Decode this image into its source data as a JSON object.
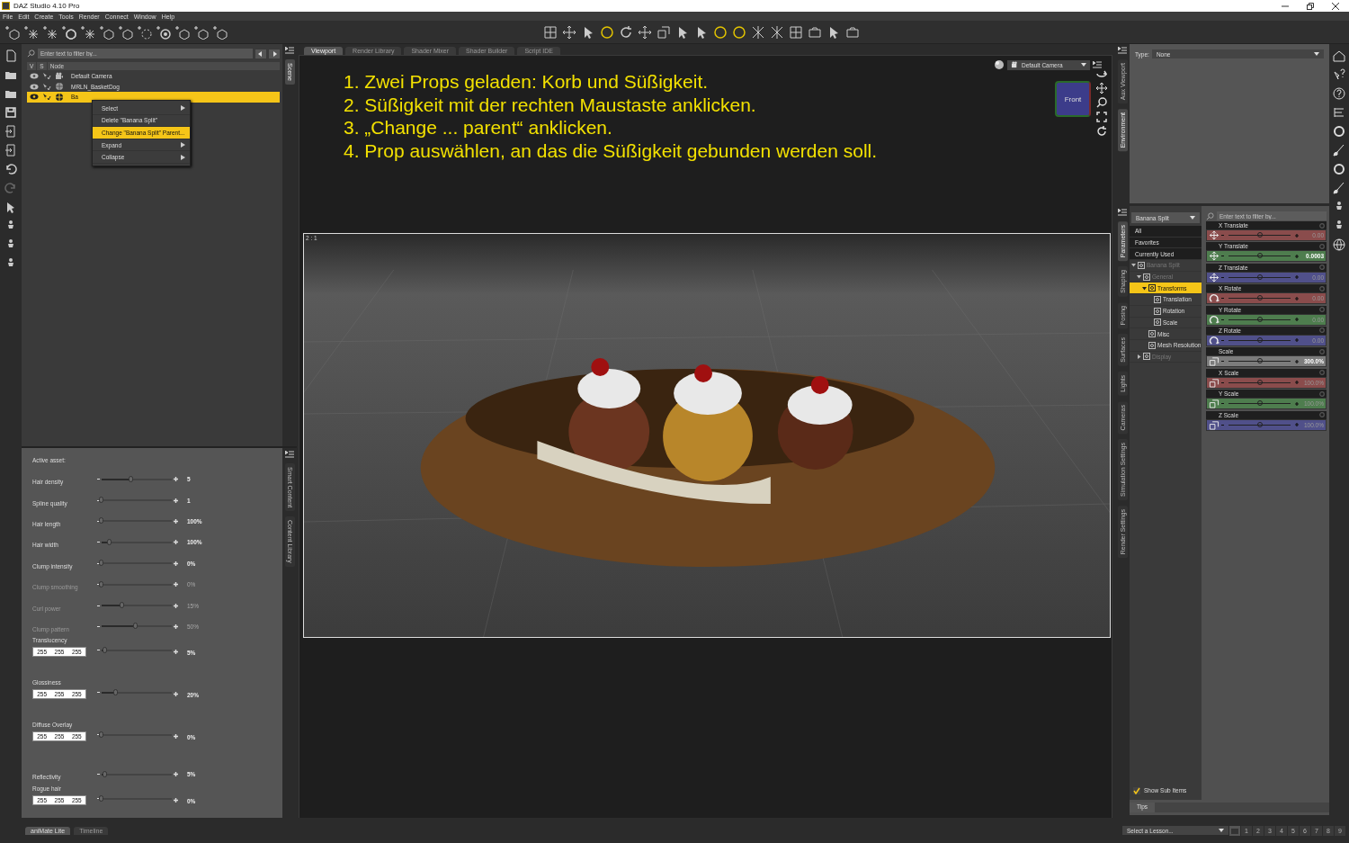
{
  "window": {
    "title": "DAZ Studio 4.10 Pro"
  },
  "menu": [
    "File",
    "Edit",
    "Create",
    "Tools",
    "Render",
    "Connect",
    "Window",
    "Help"
  ],
  "scene": {
    "side_tabs": [
      {
        "label": "Scene",
        "selected": true
      }
    ],
    "filter_placeholder": "Enter text to filter by...",
    "columns": [
      "V",
      "S",
      "Node"
    ],
    "nodes": [
      {
        "name": "Default Camera",
        "kind": "camera",
        "selected": false
      },
      {
        "name": "MRLN_BasketDog",
        "kind": "prop",
        "selected": false
      },
      {
        "name": "Ba",
        "kind": "prop",
        "selected": true
      }
    ],
    "context_menu": [
      {
        "label": "Select",
        "submenu": true,
        "selected": false
      },
      {
        "label": "Delete \"Banana Split\"",
        "submenu": false,
        "selected": false
      },
      {
        "label": "Change \"Banana Split\" Parent...",
        "submenu": false,
        "selected": true
      },
      {
        "label": "Expand",
        "submenu": true,
        "selected": false
      },
      {
        "label": "Collapse",
        "submenu": true,
        "selected": false
      }
    ]
  },
  "hair_panel": {
    "side_tabs": [
      {
        "label": "Smart Content",
        "selected": false
      },
      {
        "label": "Content Library",
        "selected": false
      }
    ],
    "active_asset": "Active asset:",
    "sliders": [
      {
        "label": "Hair density",
        "level": 0.42,
        "reading": "5",
        "disabled": false
      },
      {
        "label": "Spline quality",
        "level": 0,
        "reading": "1",
        "disabled": false
      },
      {
        "label": "Hair length",
        "level": 0,
        "reading": "100%",
        "disabled": false
      },
      {
        "label": "Hair width",
        "level": 0.11,
        "reading": "100%",
        "disabled": false
      },
      {
        "label": "Clump intensity",
        "level": 0,
        "reading": "0%",
        "disabled": false
      },
      {
        "label": "Clump smoothing",
        "level": 0,
        "reading": "0%",
        "disabled": true
      },
      {
        "label": "Curl power",
        "level": 0.29,
        "reading": "15%",
        "disabled": true
      },
      {
        "label": "Clump pattern",
        "level": 0.49,
        "reading": "50%",
        "disabled": true
      },
      {
        "label": "Translucency",
        "rgb": [
          "255",
          "255",
          "255"
        ],
        "level": 0.05,
        "reading": "5%",
        "disabled": false
      },
      {
        "label": "Glossiness",
        "rgb": [
          "255",
          "255",
          "255"
        ],
        "level": 0.2,
        "reading": "20%",
        "disabled": false
      },
      {
        "label": "Diffuse Overlay",
        "rgb": [
          "255",
          "255",
          "255"
        ],
        "level": 0,
        "reading": "0%",
        "disabled": false
      },
      {
        "label": "Reflectivity",
        "level": 0.05,
        "reading": "5%",
        "disabled": false
      },
      {
        "label": "Rogue hair",
        "rgb": [
          "255",
          "255",
          "255"
        ],
        "level": 0,
        "reading": "0%",
        "disabled": false
      }
    ]
  },
  "viewport": {
    "tabs": [
      {
        "label": "Viewport",
        "selected": true
      },
      {
        "label": "Render Library",
        "selected": false
      },
      {
        "label": "Shader Mixer",
        "selected": false
      },
      {
        "label": "Shader Builder",
        "selected": false
      },
      {
        "label": "Script IDE",
        "selected": false
      }
    ],
    "camera": "Default Camera",
    "cube_face": "Front",
    "ratio": "2 : 1",
    "instructions": [
      "1. Zwei Props geladen: Korb und Süßigkeit.",
      "2. Süßigkeit mit der rechten Maustaste anklicken.",
      "3. „Change ... parent“ anklicken.",
      "4. Prop auswählen, an das die Süßigkeit gebunden werden soll."
    ]
  },
  "aux_panel": {
    "side_tabs": [
      {
        "label": "Aux Viewport",
        "selected": false
      },
      {
        "label": "Environment",
        "selected": true
      }
    ],
    "type_label": "Type:",
    "type_value": "None"
  },
  "parameters": {
    "side_tabs": [
      {
        "label": "Parameters",
        "selected": true
      },
      {
        "label": "Shaping",
        "selected": false
      },
      {
        "label": "Posing",
        "selected": false
      },
      {
        "label": "Surfaces",
        "selected": false
      },
      {
        "label": "Lights",
        "selected": false
      },
      {
        "label": "Cameras",
        "selected": false
      },
      {
        "label": "Simulation Settings",
        "selected": false
      },
      {
        "label": "Render Settings",
        "selected": false
      }
    ],
    "node_select": "Banana Split",
    "filters": [
      "All",
      "Favorites",
      "Currently Used"
    ],
    "tree": [
      {
        "label": "Banana Split",
        "expanded": true,
        "selected": false,
        "dimmed": true,
        "children": [
          {
            "label": "General",
            "expanded": true,
            "selected": false,
            "dimmed": true,
            "children": [
              {
                "label": "Transforms",
                "expanded": true,
                "selected": true,
                "dimmed": false,
                "children": [
                  {
                    "label": "Translation",
                    "selected": false,
                    "dimmed": false
                  },
                  {
                    "label": "Rotation",
                    "selected": false,
                    "dimmed": false
                  },
                  {
                    "label": "Scale",
                    "selected": false,
                    "dimmed": false
                  }
                ]
              },
              {
                "label": "Misc",
                "selected": false,
                "dimmed": false
              },
              {
                "label": "Mesh Resolution",
                "selected": false,
                "dimmed": false
              }
            ]
          },
          {
            "label": "Display",
            "expanded": false,
            "selected": false,
            "dimmed": true
          }
        ]
      }
    ],
    "filter_placeholder": "Enter text to filter by...",
    "properties": [
      {
        "name": "X Translate",
        "kind": "translate",
        "color": "#8a4c4c",
        "value": "0.00",
        "modified": false,
        "level": 0.5
      },
      {
        "name": "Y Translate",
        "kind": "translate",
        "color": "#4e7d4e",
        "value": "0.0003",
        "modified": true,
        "level": 0.5
      },
      {
        "name": "Z Translate",
        "kind": "translate",
        "color": "#50508a",
        "value": "0.00",
        "modified": false,
        "level": 0.5
      },
      {
        "name": "X Rotate",
        "kind": "rotate",
        "color": "#8a4c4c",
        "value": "0.00",
        "modified": false,
        "level": 0.5
      },
      {
        "name": "Y Rotate",
        "kind": "rotate",
        "color": "#4e7d4e",
        "value": "0.00",
        "modified": false,
        "level": 0.5
      },
      {
        "name": "Z Rotate",
        "kind": "rotate",
        "color": "#50508a",
        "value": "0.00",
        "modified": false,
        "level": 0.5
      },
      {
        "name": "Scale",
        "kind": "scale",
        "color": "#7c7c7c",
        "value": "300.0%",
        "modified": true,
        "level": 0.5
      },
      {
        "name": "X Scale",
        "kind": "scale",
        "color": "#8a4c4c",
        "value": "100.0%",
        "modified": false,
        "level": 0.5
      },
      {
        "name": "Y Scale",
        "kind": "scale",
        "color": "#4e7d4e",
        "value": "100.0%",
        "modified": false,
        "level": 0.5
      },
      {
        "name": "Z Scale",
        "kind": "scale",
        "color": "#50508a",
        "value": "100.0%",
        "modified": false,
        "level": 0.5
      }
    ],
    "show_sub_items": {
      "label": "Show Sub Items",
      "checked": true
    },
    "tips": "Tips"
  },
  "lesson": {
    "placeholder": "Select a Lesson...",
    "steps": [
      "1",
      "2",
      "3",
      "4",
      "5",
      "6",
      "7",
      "8",
      "9"
    ]
  },
  "bottom_tabs": [
    {
      "label": "aniMate Lite",
      "selected": true
    },
    {
      "label": "Timeline",
      "selected": false
    }
  ]
}
